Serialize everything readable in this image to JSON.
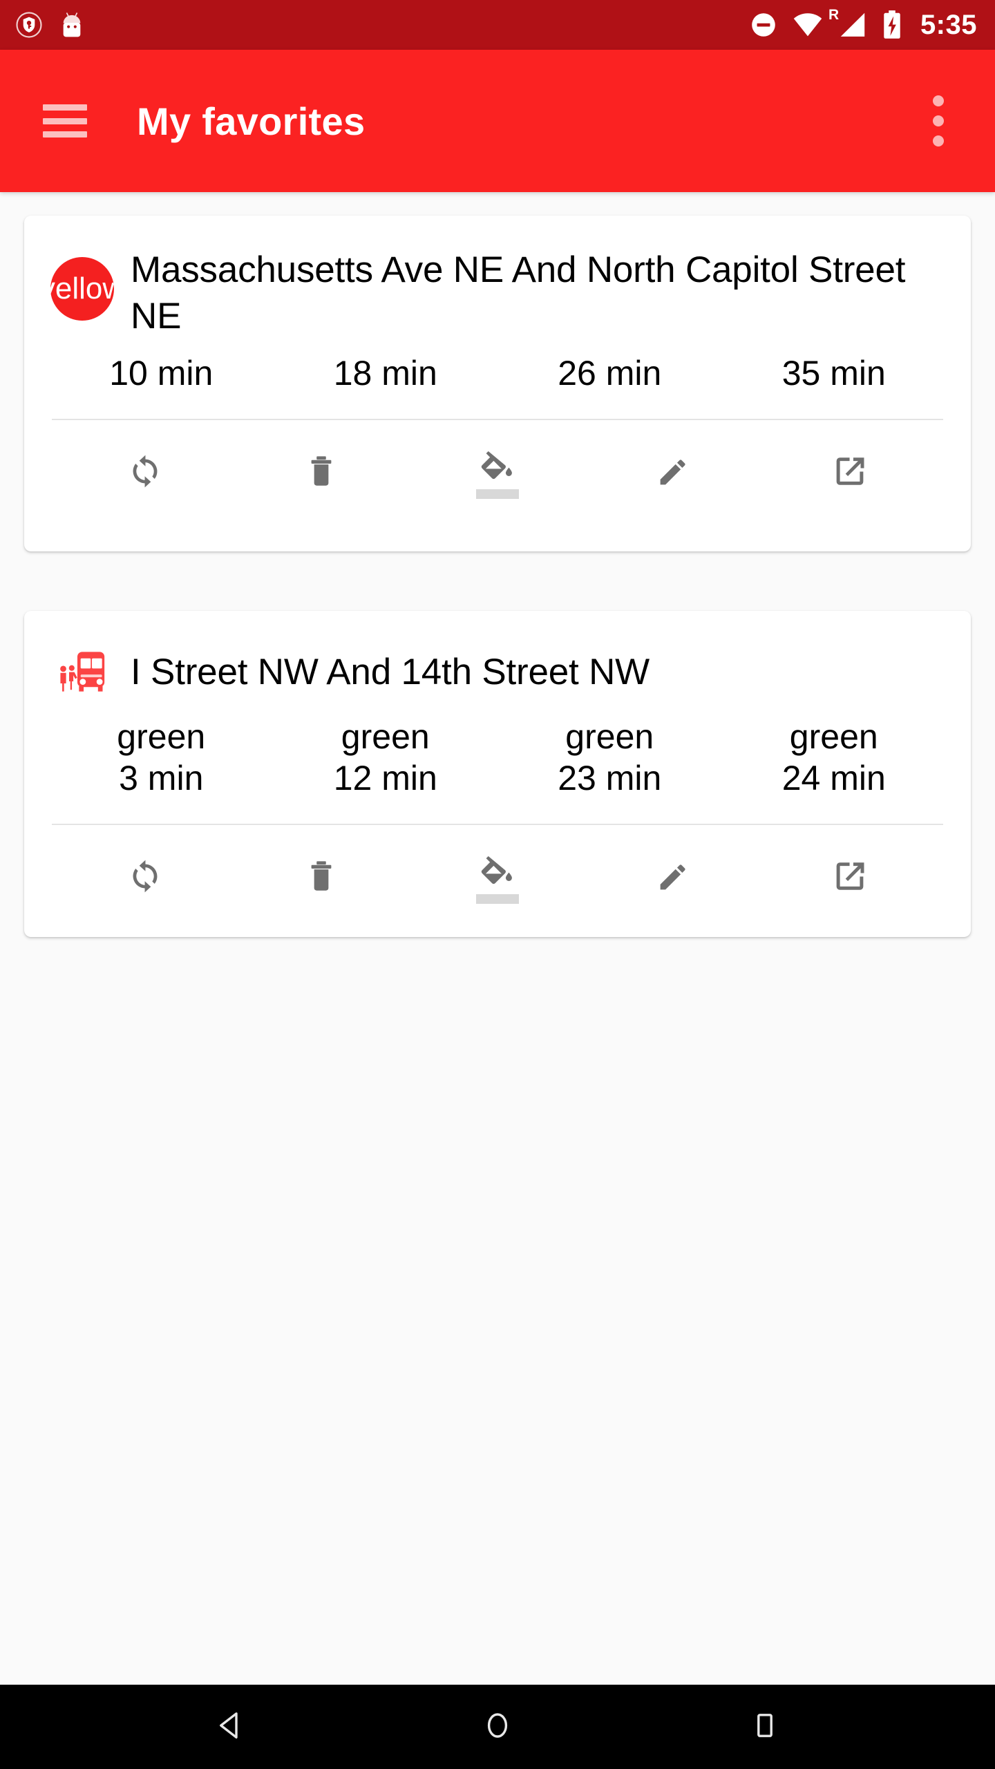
{
  "status_bar": {
    "background": "#b01116",
    "left_icons": [
      {
        "name": "vpn-key-shield-icon",
        "label": "vpn-shield"
      },
      {
        "name": "android-head-icon",
        "label": "android"
      }
    ],
    "right_icons": [
      {
        "name": "do-not-disturb-icon",
        "label": "do-not-disturb"
      },
      {
        "name": "wifi-icon",
        "label": "wifi"
      },
      {
        "name": "cell-signal-roaming-icon",
        "label": "signal",
        "badge": "R"
      },
      {
        "name": "battery-charging-icon",
        "label": "battery-charging"
      }
    ],
    "time": "5:35"
  },
  "app_bar": {
    "background": "#fb2222",
    "icon_tint": "#fcbfbf",
    "menu_icon": "hamburger-menu-icon",
    "title": "My favorites",
    "overflow_icon": "more-vert-icon"
  },
  "actions": [
    {
      "name": "refresh",
      "icon": "refresh-icon",
      "label": "Refresh"
    },
    {
      "name": "delete",
      "icon": "delete-trash-icon",
      "label": "Delete"
    },
    {
      "name": "color",
      "icon": "format-color-fill-icon",
      "label": "Set color",
      "swatch": "#d8d8d8"
    },
    {
      "name": "edit",
      "icon": "edit-pencil-icon",
      "label": "Edit"
    },
    {
      "name": "open",
      "icon": "open-in-new-icon",
      "label": "Open"
    }
  ],
  "cards": [
    {
      "id": "card-1",
      "avatar_type": "circle-badge",
      "avatar_color": "#f42020",
      "avatar_text": "yellow",
      "title": "Massachusetts Ave NE And North Capitol Street NE",
      "departures": [
        {
          "route": "",
          "time": "10 min"
        },
        {
          "route": "",
          "time": "18 min"
        },
        {
          "route": "",
          "time": "26 min"
        },
        {
          "route": "",
          "time": "35 min"
        }
      ]
    },
    {
      "id": "card-2",
      "avatar_type": "bus-stop-icon",
      "avatar_color": "#fb4444",
      "avatar_text": "",
      "title": "I Street NW And 14th Street NW",
      "departures": [
        {
          "route": "green",
          "time": "3 min"
        },
        {
          "route": "green",
          "time": "12 min"
        },
        {
          "route": "green",
          "time": "23 min"
        },
        {
          "route": "green",
          "time": "24 min"
        }
      ]
    }
  ],
  "nav_bar": {
    "background": "#000000",
    "buttons": [
      {
        "name": "back-button",
        "icon": "back-triangle-icon"
      },
      {
        "name": "home-button",
        "icon": "home-circle-icon"
      },
      {
        "name": "recents-button",
        "icon": "recents-square-icon"
      }
    ]
  }
}
